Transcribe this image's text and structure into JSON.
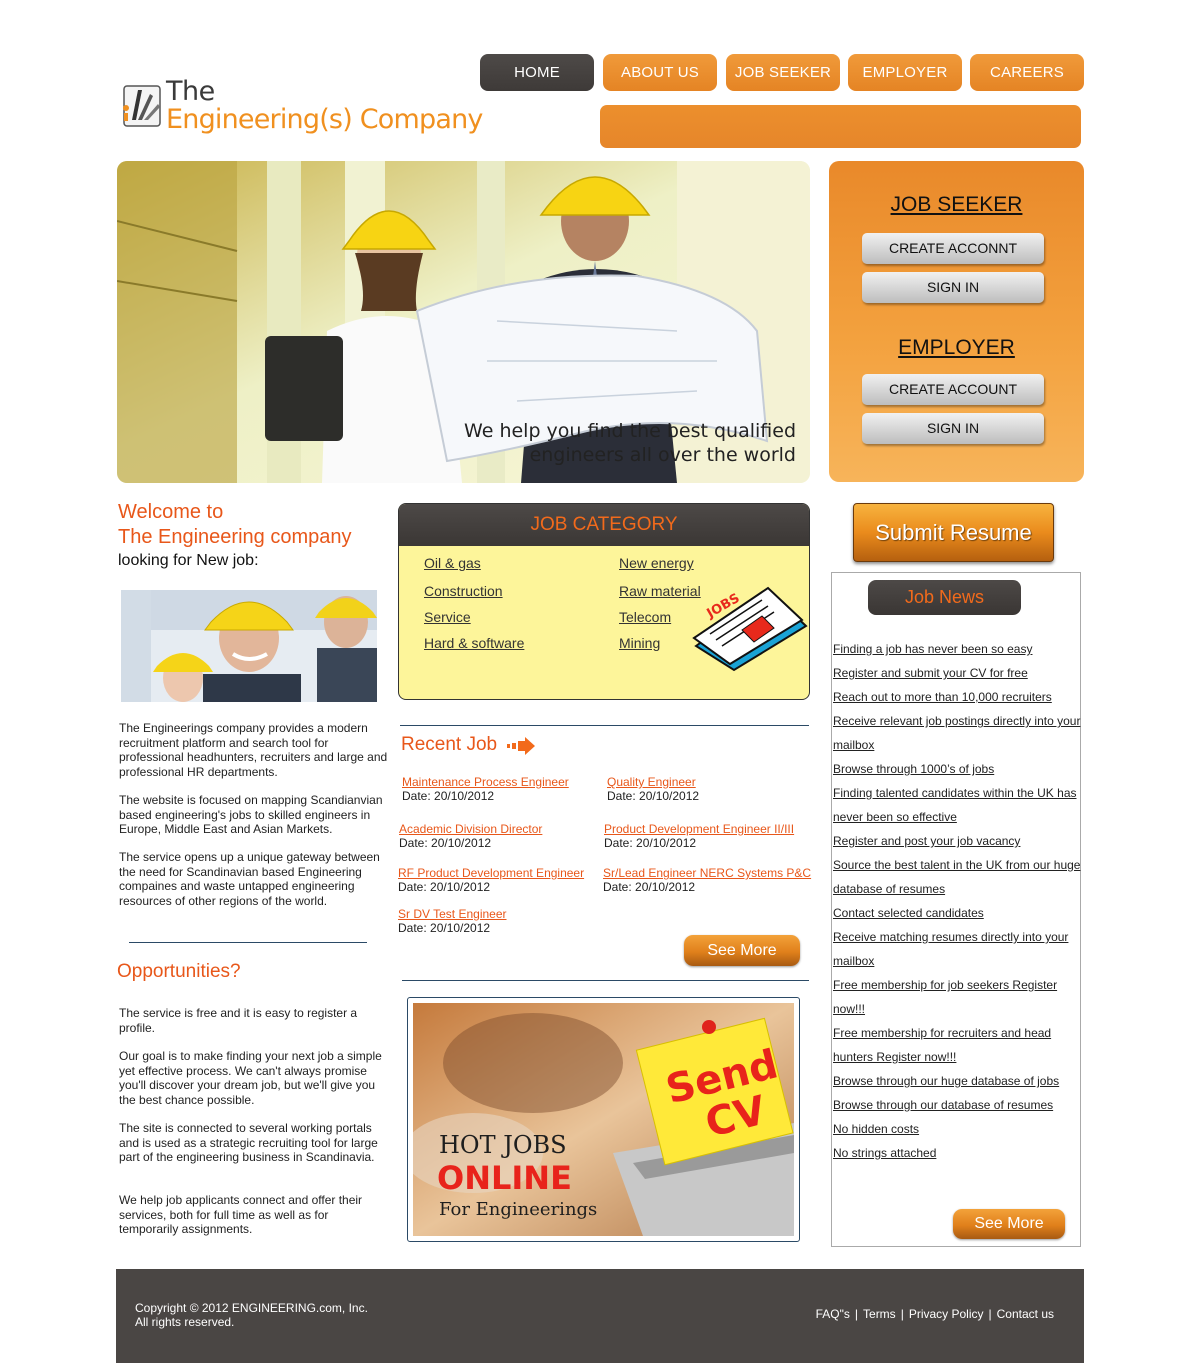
{
  "logo": {
    "line1": "The",
    "line2": "Engineering(s) Company"
  },
  "nav": [
    "HOME",
    "ABOUT US",
    "JOB SEEKER",
    "EMPLOYER",
    "CAREERS"
  ],
  "hero": {
    "caption_line1": "We help you find the best qualified",
    "caption_line2": "engineers all over the world"
  },
  "sidebox": {
    "seeker_title": "JOB SEEKER",
    "seeker_create": "CREATE ACCONNT",
    "seeker_signin": "SIGN IN",
    "employer_title": "EMPLOYER",
    "employer_create": "CREATE ACCOUNT",
    "employer_signin": "SIGN IN"
  },
  "welcome": {
    "line1": "Welcome to",
    "line2": "The Engineering company",
    "sub": "looking for New job:"
  },
  "left_paragraphs": [
    "The Engineerings company provides a modern recruitment platform and search tool for professional headhunters, recruiters and large and professional HR departments.",
    "The website is focused on mapping Scandianvian based engineering's jobs to skilled engineers in Europe, Middle East and Asian Markets.",
    "The service opens up a unique gateway between the need for Scandinavian based Engineering compaines and waste untapped engineering resources of other regions of the world."
  ],
  "opportunities": {
    "title": "Opportunities?",
    "paragraphs": [
      "The service is free and it is easy to register a profile.",
      "Our goal is to make finding your next job a simple yet effective process. We can't always promise you'll discover your dream job, but we'll give you the best chance possible.",
      "The site is connected to several working portals and is used as a strategic recruiting tool for large part of the engineering business in Scandinavia.",
      "We help job applicants connect and offer their services, both for full time as well as for temporarily assignments."
    ]
  },
  "category": {
    "title": "JOB CATEGORY",
    "col1": [
      "Oil & gas",
      "Construction",
      "Service",
      "Hard & software"
    ],
    "col2": [
      "New energy",
      "Raw material",
      "Telecom",
      "Mining"
    ],
    "art_label": "JOBS"
  },
  "recent": {
    "title": "Recent Job",
    "jobs": [
      {
        "title": "Maintenance Process Engineer",
        "date": "Date: 20/10/2012"
      },
      {
        "title": "Quality Engineer",
        "date": "Date: 20/10/2012"
      },
      {
        "title": "Academic Division Director",
        "date": "Date: 20/10/2012"
      },
      {
        "title": "Product Development Engineer II/III",
        "date": "Date: 20/10/2012"
      },
      {
        "title": "RF Product Development Engineer",
        "date": "Date: 20/10/2012"
      },
      {
        "title": "Sr/Lead Engineer NERC Systems P&C",
        "date": "Date: 20/10/2012"
      },
      {
        "title": "Sr DV Test Engineer",
        "date": "Date: 20/10/2012"
      }
    ],
    "see_more": "See More"
  },
  "sendcv": {
    "line1": "HOT JOBS",
    "line2": "ONLINE",
    "line3": "For Engineerings",
    "note1": "Send",
    "note2": "CV"
  },
  "submit_resume": "Submit Resume",
  "news": {
    "title": "Job News",
    "items": [
      "Finding a job has never been so easy",
      "Register and submit your CV for free",
      "Reach out to more than 10,000 recruiters",
      "Receive relevant job postings directly into your mailbox",
      "Browse through 1000’s of jobs",
      "Finding talented candidates within the UK has never been so effective",
      "Register and post your job vacancy",
      "Source the best talent in the UK from our huge database of resumes",
      "Contact selected candidates",
      "Receive matching resumes directly into your mailbox",
      "Free membership for job seekers Register now!!!",
      "Free membership for recruiters and head hunters Register now!!!",
      "Browse through our huge database of jobs",
      "Browse through our database of resumes",
      "No hidden costs",
      "No strings attached"
    ],
    "see_more": "See More"
  },
  "footer": {
    "copy_line1": "Copyright © 2012 ENGINEERING.com, Inc.",
    "copy_line2": "All rights reserved.",
    "links": [
      "FAQ\"s",
      "Terms",
      "Privacy Policy",
      "Contact us"
    ]
  },
  "colors": {
    "orange": "#e8891f",
    "dark": "#4a4644",
    "accent_text": "#e8571a",
    "category_bg": "#fdf59a"
  }
}
